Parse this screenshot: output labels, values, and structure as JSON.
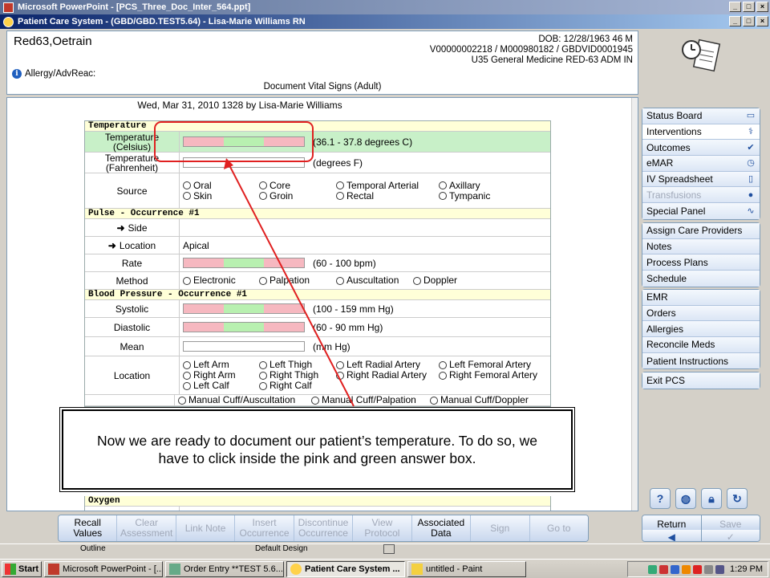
{
  "window": {
    "ppt_title": "Microsoft PowerPoint - [PCS_Three_Doc_Inter_564.ppt]",
    "pcs_title": "Patient Care System - (GBD/GBD.TEST5.64) - Lisa-Marie Williams RN"
  },
  "patient": {
    "name": "Red63,Oetrain",
    "dob": "DOB: 12/28/1963 46 M",
    "ids": "V00000002218 / M000980182 / GBDVID0001945",
    "location": "U35 General Medicine  RED-63  ADM IN",
    "allergy": "Allergy/AdvReac:",
    "document_title": "Document Vital Signs (Adult)"
  },
  "form": {
    "date_line": "Wed,  Mar 31, 2010 1328  by  Lisa-Marie Williams",
    "temperature": {
      "header": "Temperature",
      "celsius_label_1": "Temperature",
      "celsius_label_2": "(Celsius)",
      "celsius_hint": "(36.1 - 37.8 degrees C)",
      "fahrenheit_label_1": "Temperature",
      "fahrenheit_label_2": "(Fahrenheit)",
      "fahrenheit_hint": "(degrees F)",
      "source_label": "Source",
      "source_options": [
        "Oral",
        "Core",
        "Temporal Arterial",
        "Axillary",
        "Skin",
        "Groin",
        "Rectal",
        "Tympanic"
      ]
    },
    "pulse": {
      "header": "Pulse - Occurrence #1",
      "side_label": "Side",
      "location_label": "Location",
      "location_value": "Apical",
      "rate_label": "Rate",
      "rate_hint": "(60 - 100 bpm)",
      "method_label": "Method",
      "method_options": [
        "Electronic",
        "Palpation",
        "Auscultation",
        "Doppler"
      ]
    },
    "bp": {
      "header": "Blood Pressure - Occurrence #1",
      "systolic_label": "Systolic",
      "systolic_hint": "(100 - 159 mm Hg)",
      "diastolic_label": "Diastolic",
      "diastolic_hint": "(60 - 90 mm Hg)",
      "mean_label": "Mean",
      "mean_hint": "(mm Hg)",
      "location_label": "Location",
      "location_options": [
        "Left Arm",
        "Left Thigh",
        "Left Radial Artery",
        "Left Femoral Artery",
        "Right Arm",
        "Right Thigh",
        "Right Radial Artery",
        "Right Femoral Artery",
        "Left Calf",
        "Right Calf"
      ],
      "method_options_partial": [
        "Manual Cuff/Auscultation",
        "Manual Cuff/Palpation",
        "Manual Cuff/Doppler"
      ]
    },
    "oxygen": {
      "header": "Oxygen"
    }
  },
  "callout": {
    "text": "Now we are ready to document our patient’s temperature. To do so, we have to click inside the pink and green answer box."
  },
  "sidebar": {
    "group1": [
      {
        "label": "Status Board",
        "icon": "book-icon",
        "state": "normal"
      },
      {
        "label": "Interventions",
        "icon": "pills-icon",
        "state": "active"
      },
      {
        "label": "Outcomes",
        "icon": "check-clipboard-icon",
        "state": "normal"
      },
      {
        "label": "eMAR",
        "icon": "clock-clipboard-icon",
        "state": "normal"
      },
      {
        "label": "IV Spreadsheet",
        "icon": "iv-bag-icon",
        "state": "normal"
      },
      {
        "label": "Transfusions",
        "icon": "blood-drop-icon",
        "state": "disabled"
      },
      {
        "label": "Special Panel",
        "icon": "heartbeat-icon",
        "state": "normal"
      }
    ],
    "group2": [
      "Assign Care Providers",
      "Notes",
      "Process Plans",
      "Schedule"
    ],
    "group3": [
      "EMR",
      "Orders",
      "Allergies",
      "Reconcile Meds",
      "Patient Instructions"
    ],
    "group4": [
      "Exit PCS"
    ],
    "return_label": "Return",
    "save_label": "Save"
  },
  "toolbar": [
    {
      "label": "Recall Values",
      "enabled": true
    },
    {
      "label": "Clear Assessment",
      "enabled": false
    },
    {
      "label": "Link Note",
      "enabled": false
    },
    {
      "label": "Insert Occurrence",
      "enabled": false
    },
    {
      "label": "Discontinue Occurrence",
      "enabled": false
    },
    {
      "label": "View Protocol",
      "enabled": false
    },
    {
      "label": "Associated Data",
      "enabled": true
    },
    {
      "label": "Sign",
      "enabled": false
    },
    {
      "label": "Go to",
      "enabled": false
    }
  ],
  "ppt_status": {
    "outline": "Outline",
    "design": "Default Design"
  },
  "taskbar": {
    "start": "Start",
    "tasks": [
      "Microsoft PowerPoint - [...",
      "Order Entry **TEST 5.6...",
      "Patient Care System ...",
      "untitled - Paint"
    ],
    "clock": "1:29 PM"
  },
  "colors": {
    "range_pink": "#f6b8c0",
    "range_green": "#b8f0b0",
    "highlight_row": "#c8f0c8",
    "annotation_red": "#e02020"
  }
}
